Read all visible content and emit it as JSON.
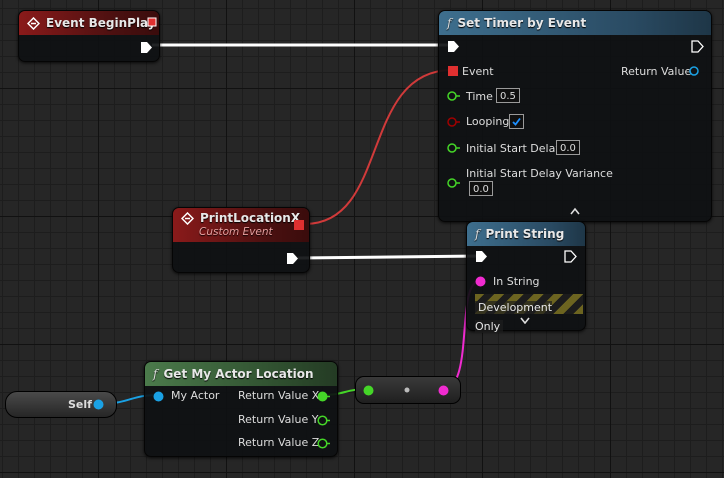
{
  "colors": {
    "exec": "#ffffff",
    "event": "#e03030",
    "float": "#45d628",
    "bool": "#a00000",
    "string": "#f02bd0",
    "object": "#1aa1e4"
  },
  "event_begin_play": {
    "title": "Event BeginPlay"
  },
  "set_timer": {
    "title": "Set Timer by Event",
    "func_icon": "f",
    "event_label": "Event",
    "return_label": "Return Value",
    "time_label": "Time",
    "time_value": "0.5",
    "looping_label": "Looping",
    "looping_checked": true,
    "initial_delay_label": "Initial Start Delay",
    "initial_delay_value": "0.0",
    "variance_label": "Initial Start Delay Variance",
    "variance_value": "0.0"
  },
  "print_location": {
    "title": "PrintLocationX",
    "subtitle": "Custom Event"
  },
  "print_string": {
    "title": "Print String",
    "func_icon": "f",
    "in_string_label": "In String",
    "dev_only_label": "Development Only"
  },
  "get_location": {
    "title": "Get My Actor Location",
    "func_icon": "f",
    "input_label": "My Actor",
    "out_x": "Return Value X",
    "out_y": "Return Value Y",
    "out_z": "Return Value Z"
  },
  "self_node": {
    "label": "Self"
  }
}
